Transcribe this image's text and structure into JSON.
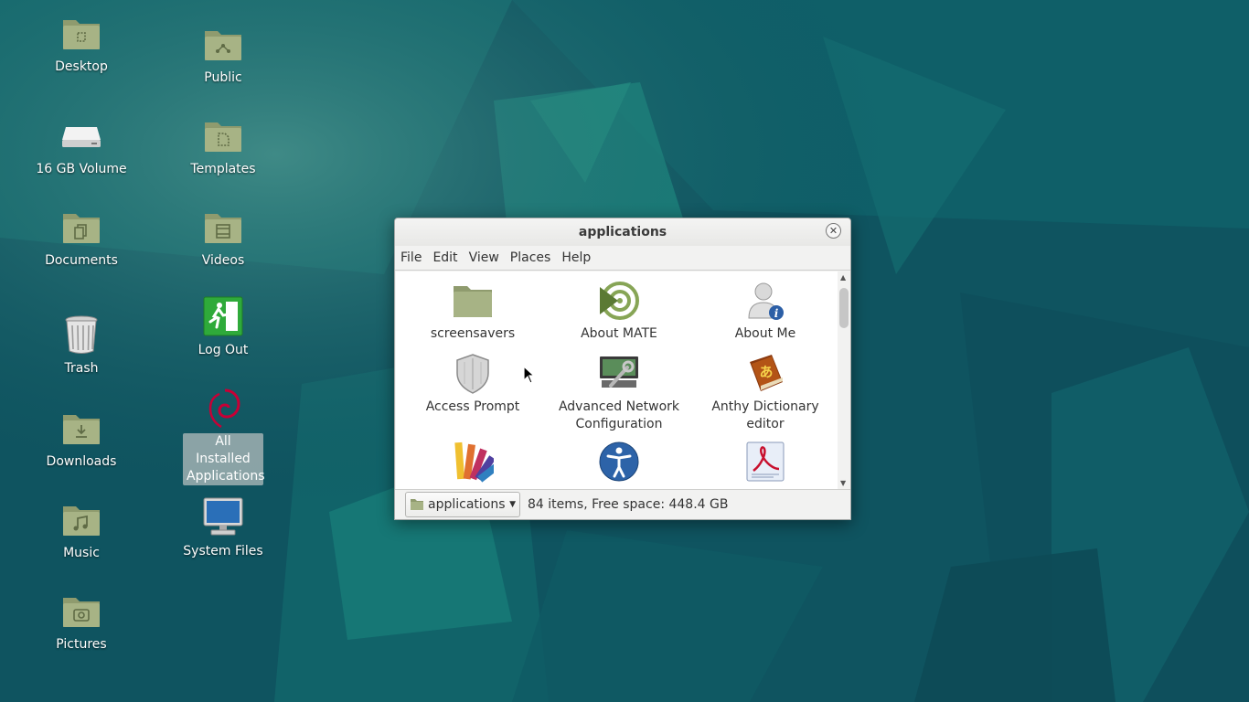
{
  "desktop": {
    "icons": [
      {
        "label": "Desktop",
        "icon": "folder-desktop-icon"
      },
      {
        "label": "16 GB Volume",
        "icon": "drive-icon"
      },
      {
        "label": "Documents",
        "icon": "folder-documents-icon"
      },
      {
        "label": "Trash",
        "icon": "trash-icon"
      },
      {
        "label": "Downloads",
        "icon": "folder-downloads-icon"
      },
      {
        "label": "Music",
        "icon": "folder-music-icon"
      },
      {
        "label": "Pictures",
        "icon": "folder-pictures-icon"
      },
      {
        "label": "Public",
        "icon": "folder-public-icon"
      },
      {
        "label": "Templates",
        "icon": "folder-templates-icon"
      },
      {
        "label": "Videos",
        "icon": "folder-videos-icon"
      },
      {
        "label": "Log Out",
        "icon": "logout-icon"
      },
      {
        "label": "All Installed Applications",
        "icon": "debian-swirl-icon",
        "selected": true
      },
      {
        "label": "System Files",
        "icon": "computer-icon"
      }
    ]
  },
  "window": {
    "title": "applications",
    "menu": [
      "File",
      "Edit",
      "View",
      "Places",
      "Help"
    ],
    "items": [
      {
        "label": "screensavers",
        "icon": "folder-icon"
      },
      {
        "label": "About MATE",
        "icon": "mate-logo-icon"
      },
      {
        "label": "About Me",
        "icon": "user-info-icon"
      },
      {
        "label": "Access Prompt",
        "icon": "shield-icon"
      },
      {
        "label": "Advanced Network Configuration",
        "icon": "network-config-icon"
      },
      {
        "label": "Anthy Dictionary editor",
        "icon": "dictionary-book-icon"
      },
      {
        "label": "",
        "icon": "color-palette-icon"
      },
      {
        "label": "",
        "icon": "accessibility-icon"
      },
      {
        "label": "",
        "icon": "pdf-reader-icon"
      }
    ],
    "statusbar": {
      "path_label": "applications",
      "status_text": "84 items, Free space: 448.4 GB"
    }
  },
  "colors": {
    "desktop_bg": "#0f5560",
    "folder": "#9aa67c",
    "selection": "#b4bebe"
  }
}
